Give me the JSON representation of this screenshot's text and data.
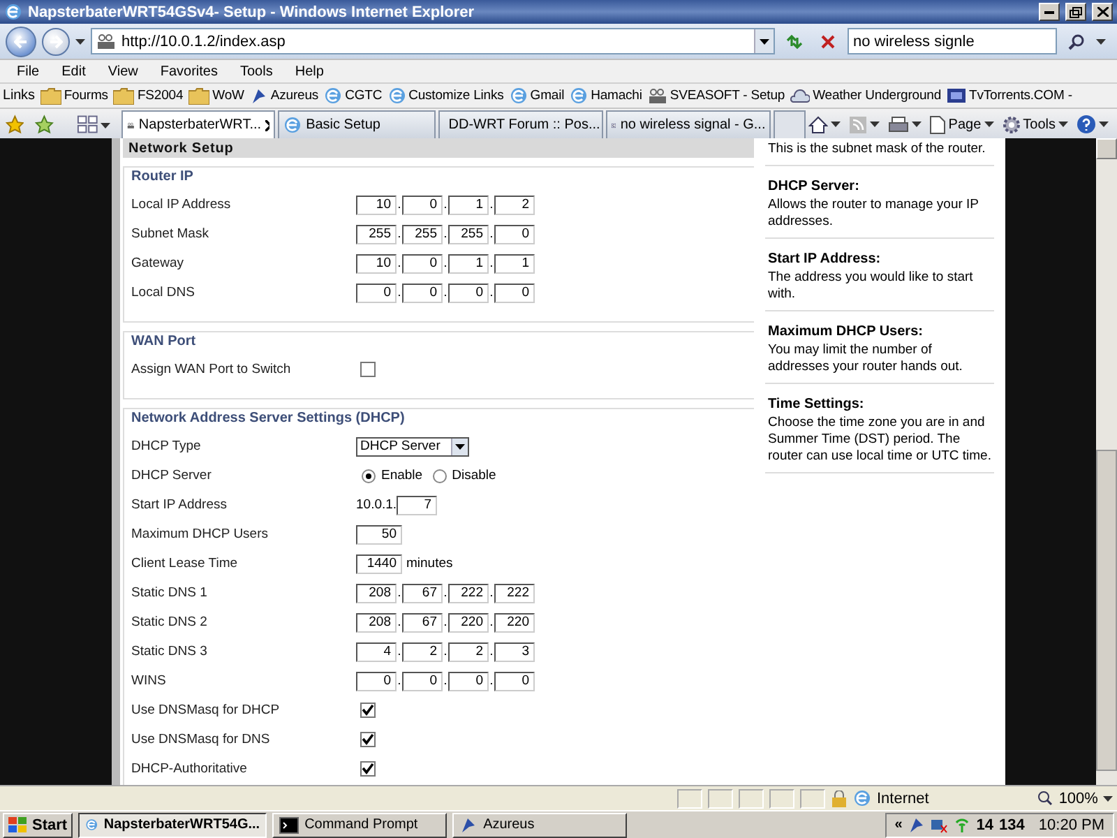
{
  "window": {
    "title": "NapsterbaterWRT54GSv4- Setup - Windows Internet Explorer"
  },
  "address": {
    "url": "http://10.0.1.2/index.asp"
  },
  "search": {
    "value": "no wireless signle"
  },
  "menu": [
    "File",
    "Edit",
    "View",
    "Favorites",
    "Tools",
    "Help"
  ],
  "links": {
    "label": "Links",
    "items": [
      {
        "label": "Fourms",
        "kind": "folder"
      },
      {
        "label": "FS2004",
        "kind": "folder"
      },
      {
        "label": "WoW",
        "kind": "folder"
      },
      {
        "label": "Azureus",
        "kind": "app"
      },
      {
        "label": "CGTC",
        "kind": "page"
      },
      {
        "label": "Customize Links",
        "kind": "page"
      },
      {
        "label": "Gmail",
        "kind": "page"
      },
      {
        "label": "Hamachi",
        "kind": "page"
      },
      {
        "label": "SVEASOFT - Setup",
        "kind": "router"
      },
      {
        "label": "Weather Underground",
        "kind": "weather"
      },
      {
        "label": "TvTorrents.COM -",
        "kind": "tv"
      }
    ]
  },
  "tabs": [
    {
      "label": "NapsterbaterWRT...",
      "selected": true,
      "kind": "router"
    },
    {
      "label": "Basic Setup",
      "selected": false,
      "kind": "page"
    },
    {
      "label": "DD-WRT Forum :: Pos...",
      "selected": false,
      "kind": "router"
    },
    {
      "label": "no wireless signal - G...",
      "selected": false,
      "kind": "google"
    }
  ],
  "command_bar": [
    {
      "kind": "home"
    },
    {
      "kind": "feed"
    },
    {
      "kind": "print"
    },
    {
      "kind": "page",
      "label": "Page"
    },
    {
      "kind": "tools",
      "label": "Tools"
    },
    {
      "kind": "help"
    }
  ],
  "setup": {
    "header": "Network Setup",
    "sections": [
      {
        "title": "Router IP",
        "rows": [
          {
            "label": "Local IP Address",
            "kind": "ip",
            "separator": ".",
            "octets": [
              "10",
              "0",
              "1",
              "2"
            ]
          },
          {
            "label": "Subnet Mask",
            "kind": "ip",
            "separator": ".",
            "octets": [
              "255",
              "255",
              "255",
              "0"
            ]
          },
          {
            "label": "Gateway",
            "kind": "ip",
            "separator": ".",
            "octets": [
              "10",
              "0",
              "1",
              "1"
            ]
          },
          {
            "label": "Local DNS",
            "kind": "ip",
            "separator": ".",
            "octets": [
              "0",
              "0",
              "0",
              "0"
            ]
          }
        ]
      },
      {
        "title": "WAN Port",
        "rows": [
          {
            "label": "Assign WAN Port to Switch",
            "kind": "checkbox",
            "checked": false
          }
        ]
      },
      {
        "title": "Network Address Server Settings (DHCP)",
        "rows": [
          {
            "label": "DHCP Type",
            "kind": "select",
            "value": "DHCP Server"
          },
          {
            "label": "DHCP Server",
            "kind": "radio",
            "options": [
              {
                "label": "Enable",
                "selected": true
              },
              {
                "label": "Disable",
                "selected": false
              }
            ]
          },
          {
            "label": "Start IP Address",
            "kind": "prefix",
            "prefix": "10.0.1.",
            "value": "7"
          },
          {
            "label": "Maximum DHCP Users",
            "kind": "number",
            "value": "50"
          },
          {
            "label": "Client Lease Time",
            "kind": "number",
            "value": "1440",
            "suffix": "minutes"
          },
          {
            "label": "Static DNS 1",
            "kind": "ip",
            "separator": ".",
            "octets": [
              "208",
              "67",
              "222",
              "222"
            ]
          },
          {
            "label": "Static DNS 2",
            "kind": "ip",
            "separator": ".",
            "octets": [
              "208",
              "67",
              "220",
              "220"
            ]
          },
          {
            "label": "Static DNS 3",
            "kind": "ip",
            "separator": ".",
            "octets": [
              "4",
              "2",
              "2",
              "3"
            ]
          },
          {
            "label": "WINS",
            "kind": "ip",
            "separator": ".",
            "octets": [
              "0",
              "0",
              "0",
              "0"
            ]
          },
          {
            "label": "Use DNSMasq for DHCP",
            "kind": "checkbox",
            "checked": true
          },
          {
            "label": "Use DNSMasq for DNS",
            "kind": "checkbox",
            "checked": true
          },
          {
            "label": "DHCP-Authoritative",
            "kind": "checkbox",
            "checked": true
          }
        ]
      }
    ]
  },
  "help": [
    {
      "text": "This is the subnet mask of the router."
    },
    {
      "title": "DHCP Server:",
      "text": "Allows the router to manage your IP addresses."
    },
    {
      "title": "Start IP Address:",
      "text": "The address you would like to start with."
    },
    {
      "title": "Maximum DHCP Users:",
      "text": "You may limit the number of addresses your router hands out."
    },
    {
      "title": "Time Settings:",
      "text": "Choose the time zone you are in and Summer Time (DST) period. The router can use local time or UTC time."
    }
  ],
  "status_bar": {
    "zone": "Internet",
    "zoom": "100%"
  },
  "taskbar": {
    "start": "Start",
    "tasks": [
      {
        "label": "NapsterbaterWRT54G...",
        "selected": true,
        "kind": "ie"
      },
      {
        "label": "Command Prompt",
        "selected": false,
        "kind": "cmd"
      },
      {
        "label": "Azureus",
        "selected": false,
        "kind": "app"
      }
    ],
    "tray_expand": "«",
    "tray": [
      "14",
      "134"
    ],
    "clock": "10:20 PM"
  }
}
